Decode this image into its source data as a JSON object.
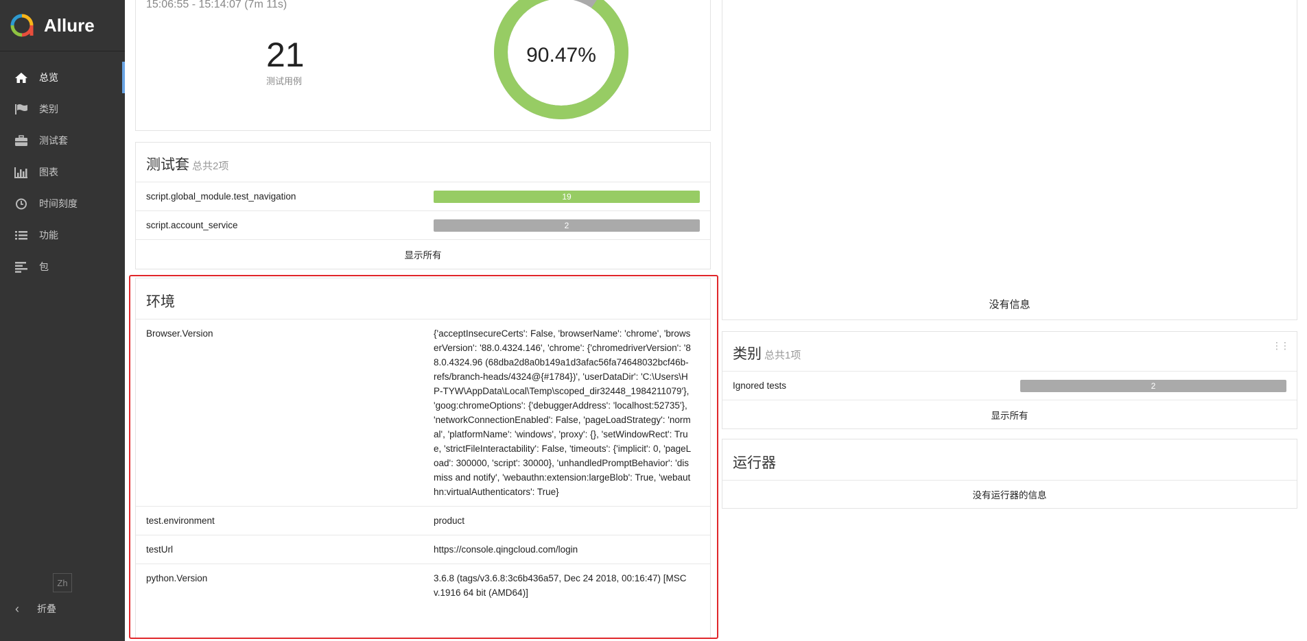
{
  "app": {
    "name": "Allure",
    "lang": "Zh",
    "collapse_label": "折叠"
  },
  "nav": [
    {
      "label": "总览",
      "icon": "home-icon",
      "active": true
    },
    {
      "label": "类别",
      "icon": "flag-icon"
    },
    {
      "label": "测试套",
      "icon": "briefcase-icon"
    },
    {
      "label": "图表",
      "icon": "bar-chart-icon"
    },
    {
      "label": "时间刻度",
      "icon": "clock-icon"
    },
    {
      "label": "功能",
      "icon": "list-icon"
    },
    {
      "label": "包",
      "icon": "align-left-icon"
    }
  ],
  "summary": {
    "time_range": "15:06:55 - 15:14:07 (7m 11s)",
    "test_count": "21",
    "test_count_label": "测试用例",
    "success_rate": "90.47%",
    "donut_fraction_pass": 0.9047
  },
  "suites": {
    "title": "测试套",
    "subtitle": "总共2项",
    "rows": [
      {
        "name": "script.global_module.test_navigation",
        "count": "19",
        "status": "passed"
      },
      {
        "name": "script.account_service",
        "count": "2",
        "status": "skipped"
      }
    ],
    "show_all": "显示所有"
  },
  "environment": {
    "title": "环境",
    "rows": [
      {
        "key": "Browser.Version",
        "value": "{'acceptInsecureCerts': False, 'browserName': 'chrome', 'browserVersion': '88.0.4324.146', 'chrome': {'chromedriverVersion': '88.0.4324.96 (68dba2d8a0b149a1d3afac56fa74648032bcf46b-refs/branch-heads/4324@{#1784})', 'userDataDir': 'C:\\Users\\HP-TYW\\AppData\\Local\\Temp\\scoped_dir32448_1984211079'}, 'goog:chromeOptions': {'debuggerAddress': 'localhost:52735'}, 'networkConnectionEnabled': False, 'pageLoadStrategy': 'normal', 'platformName': 'windows', 'proxy': {}, 'setWindowRect': True, 'strictFileInteractability': False, 'timeouts': {'implicit': 0, 'pageLoad': 300000, 'script': 30000}, 'unhandledPromptBehavior': 'dismiss and notify', 'webauthn:extension:largeBlob': True, 'webauthn:virtualAuthenticators': True}"
      },
      {
        "key": "test.environment",
        "value": "product"
      },
      {
        "key": "testUrl",
        "value": "https://console.qingcloud.com/login"
      },
      {
        "key": "python.Version",
        "value": "3.6.8 (tags/v3.6.8:3c6b436a57, Dec 24 2018, 00:16:47) [MSC v.1916 64 bit (AMD64)]"
      }
    ]
  },
  "trend": {
    "empty_message": "没有信息"
  },
  "categories": {
    "title": "类别",
    "subtitle": "总共1项",
    "rows": [
      {
        "name": "Ignored tests",
        "count": "2",
        "status": "skipped"
      }
    ],
    "show_all": "显示所有"
  },
  "executors": {
    "title": "运行器",
    "empty_message": "没有运行器的信息"
  },
  "colors": {
    "passed": "#97cc64",
    "skipped": "#aaaaaa",
    "highlight": "#e0262a",
    "sidebar": "#343434"
  }
}
